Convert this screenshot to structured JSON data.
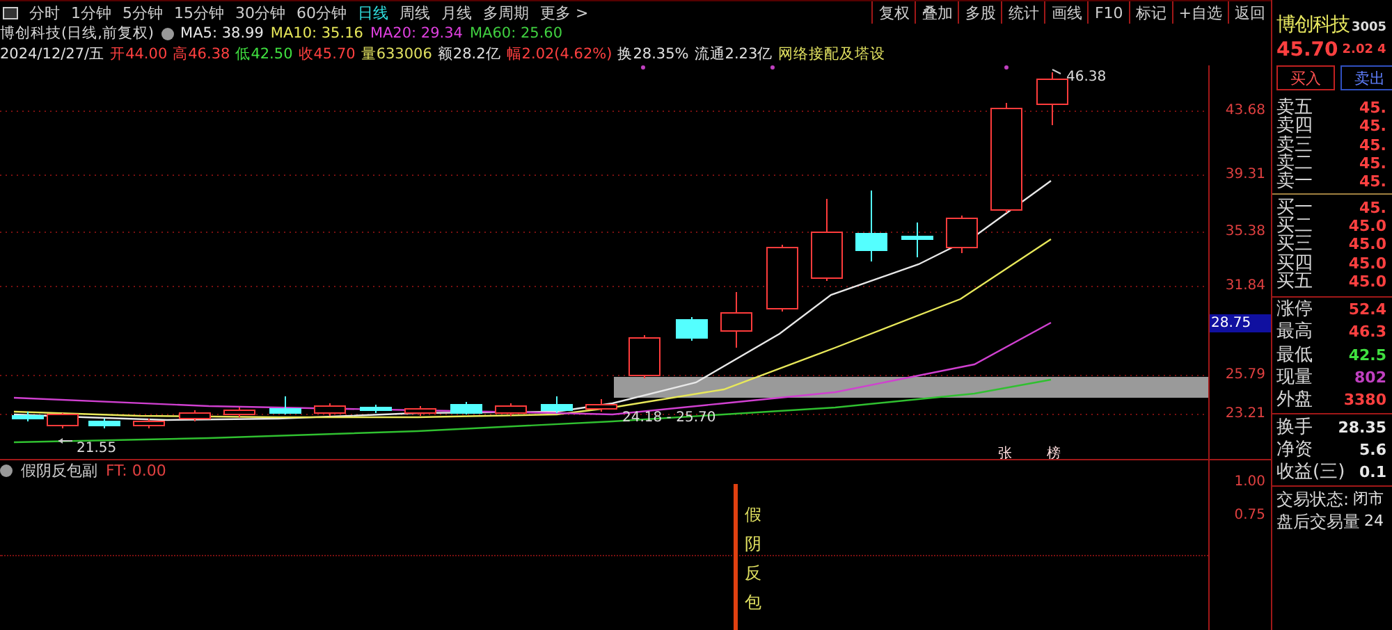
{
  "period_tabs": [
    {
      "label": "分时",
      "selected": false
    },
    {
      "label": "1分钟",
      "selected": false
    },
    {
      "label": "5分钟",
      "selected": false
    },
    {
      "label": "15分钟",
      "selected": false
    },
    {
      "label": "30分钟",
      "selected": false
    },
    {
      "label": "60分钟",
      "selected": false
    },
    {
      "label": "日线",
      "selected": true
    },
    {
      "label": "周线",
      "selected": false
    },
    {
      "label": "月线",
      "selected": false
    },
    {
      "label": "多周期",
      "selected": false
    },
    {
      "label": "更多 >",
      "selected": false
    }
  ],
  "toolbar_buttons": [
    "复权",
    "叠加",
    "多股",
    "统计",
    "画线",
    "F10",
    "标记",
    "+自选",
    "返回"
  ],
  "chart_header": {
    "title": "博创科技(日线,前复权)",
    "ma": [
      {
        "label": "MA5: 38.99",
        "color": "#e8e8e8"
      },
      {
        "label": "MA10: 35.16",
        "color": "#e8e85a"
      },
      {
        "label": "MA20: 29.34",
        "color": "#e040e0"
      },
      {
        "label": "MA60: 25.60",
        "color": "#40d040"
      }
    ]
  },
  "quote_line": [
    {
      "text": "2024/12/27/五",
      "color": "#e0e0e0"
    },
    {
      "text": "开44.00",
      "color": "#ff4040"
    },
    {
      "text": "高46.38",
      "color": "#ff4040"
    },
    {
      "text": "低42.50",
      "color": "#40e040"
    },
    {
      "text": "收45.70",
      "color": "#ff4040"
    },
    {
      "text": "量633006",
      "color": "#e0e060"
    },
    {
      "text": "额28.2亿",
      "color": "#e0e0e0"
    },
    {
      "text": "幅2.02(4.62%)",
      "color": "#ff4040"
    },
    {
      "text": "换28.35%",
      "color": "#e0e0e0"
    },
    {
      "text": "流通2.23亿",
      "color": "#e0e0e0"
    },
    {
      "text": "网络接配及塔设",
      "color": "#e0e060"
    }
  ],
  "price_axis": [
    "43.68",
    "39.31",
    "35.38",
    "31.84",
    "25.79",
    "23.21"
  ],
  "cursor_price": "28.75",
  "annotations": {
    "high": "46.38",
    "range": "24.18 - 25.70",
    "low": "21.55",
    "markers": [
      "张",
      "榜"
    ]
  },
  "sub_chart": {
    "title": "假阴反包副",
    "value": "FT: 0.00",
    "signal": "假阴反包",
    "axis": [
      "1.00",
      "0.75"
    ]
  },
  "quote_panel": {
    "name": "博创科技",
    "code": "3005",
    "price": "45.70",
    "change": "2.02",
    "percent": "4",
    "buttons": [
      {
        "label": "买入",
        "kind": "buy"
      },
      {
        "label": "卖出",
        "kind": "sell"
      }
    ],
    "asks": [
      {
        "label": "卖五",
        "value": "45."
      },
      {
        "label": "卖四",
        "value": "45."
      },
      {
        "label": "卖三",
        "value": "45."
      },
      {
        "label": "卖二",
        "value": "45."
      },
      {
        "label": "卖一",
        "value": "45."
      }
    ],
    "bids": [
      {
        "label": "买一",
        "value": "45."
      },
      {
        "label": "买二",
        "value": "45.0"
      },
      {
        "label": "买三",
        "value": "45.0"
      },
      {
        "label": "买四",
        "value": "45.0"
      },
      {
        "label": "买五",
        "value": "45.0"
      }
    ],
    "stats": [
      {
        "label": "涨停",
        "value": "52.4",
        "color": "#ff4040"
      },
      {
        "label": "最高",
        "value": "46.3",
        "color": "#ff4040"
      },
      {
        "label": "最低",
        "value": "42.5",
        "color": "#40e040"
      },
      {
        "label": "现量",
        "value": "802",
        "color": "#c040c0"
      },
      {
        "label": "外盘",
        "value": "3380",
        "color": "#ff4040"
      }
    ],
    "stats2": [
      {
        "label": "换手",
        "value": "28.35"
      },
      {
        "label": "净资",
        "value": "5.6"
      },
      {
        "label": "收益(三)",
        "value": "0.1"
      }
    ],
    "status": [
      {
        "label": "交易状态:",
        "value": "闭市"
      },
      {
        "label": "盘后交易量",
        "value": "24"
      }
    ]
  }
}
